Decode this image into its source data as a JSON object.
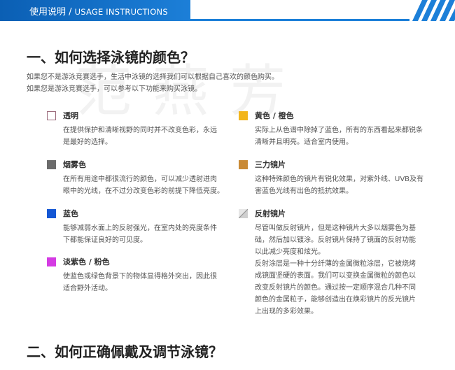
{
  "header": {
    "title_cn": "使用说明",
    "title_sep": " / ",
    "title_en": "USAGE INSTRUCTIONS"
  },
  "watermark": "范燕芳",
  "section1": {
    "title": "一、如何选择泳镜的颜色？",
    "intro": [
      "如果您不是游泳竞赛选手，生活中泳镜的选择我们可以根据自己喜欢的颜色购买。",
      "如果您是游泳竞赛选手，可以参考以下功能来购买泳镜。"
    ]
  },
  "left_items": [
    {
      "name": "透明",
      "color": "#ffffff",
      "swatch_style": "outline",
      "desc": [
        "在提供保护和清晰视野的同时并不改变色彩，永远",
        "是最好的选择。"
      ]
    },
    {
      "name": "烟雾色",
      "color": "#6b6b6b",
      "desc": [
        "在所有用途中都很流行的颜色，可以减少透射进肉",
        "眼中的光线，在不过分改变色彩的前提下降低亮度。"
      ]
    },
    {
      "name": "蓝色",
      "color": "#1457d4",
      "desc": [
        "能够减弱水面上的反射强光，在室内处的亮度条件",
        "下都能保证良好的可见度。"
      ]
    },
    {
      "name": "淡紫色 / 粉色",
      "color": "#d43be3",
      "desc": [
        "使蓝色或绿色背景下的物体显得格外突出，因此很",
        "适合野外活动。"
      ]
    }
  ],
  "right_items": [
    {
      "name": "黄色 / 橙色",
      "color": "#f2b51c",
      "desc": [
        "实际上从色谱中除掉了蓝色，所有的东西看起来都锐条",
        "清晰并且明亮。适合室内使用。"
      ]
    },
    {
      "name": "三力镜片",
      "color": "#c98a35",
      "desc": [
        "这种特殊颜色的镜片有锐化效果，对紫外线、UVB及有",
        "害蓝色光线有出色的抵抗效果。"
      ]
    },
    {
      "name": "反射镜片",
      "color": "#bdbdbd",
      "swatch_style": "mirror",
      "desc": [
        "尽管叫做反射镜片，但是这种镜片大多以烟雾色为基",
        "础，然后加以镀涂。反射镜片保持了镜面的反射功能",
        "以此减少亮度和炫光。",
        "反射涂层是一种十分纤薄的金属微粒涂层，它被烧烤",
        "成镜面坚硬的表面。我们可以变换金属微粒的颜色以",
        "改变反射镜片的颜色。通过按一定顺序混合几种不同",
        "颜色的金属粒子，能够创造出在焕彩镜片的反光镜片",
        "上出现的多彩效果。"
      ]
    }
  ],
  "section2": {
    "title": "二、如何正确佩戴及调节泳镜？"
  },
  "colors": {
    "brand_blue": "#1c7fd8"
  }
}
